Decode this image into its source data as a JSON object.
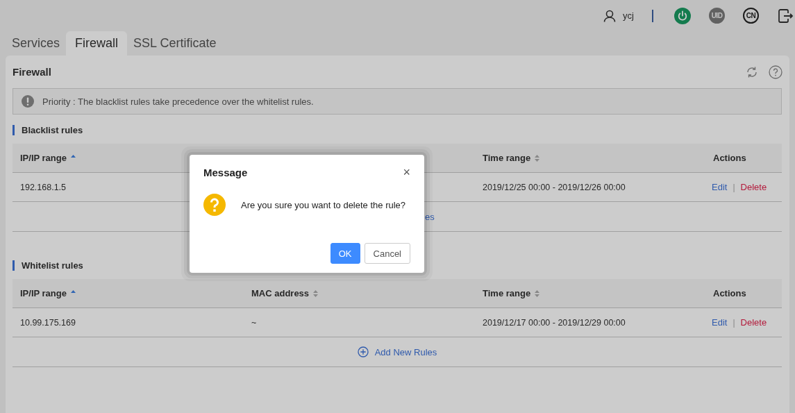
{
  "header": {
    "user": "ycj",
    "badges": [
      {
        "kind": "power"
      },
      {
        "kind": "text",
        "text": "UID",
        "filled": true
      },
      {
        "kind": "text",
        "text": "CN",
        "filled": false
      },
      {
        "kind": "logout"
      }
    ]
  },
  "tabs": [
    {
      "label": "Services",
      "selected": false
    },
    {
      "label": "Firewall",
      "selected": true
    },
    {
      "label": "SSL Certificate",
      "selected": false
    }
  ],
  "panel": {
    "title": "Firewall",
    "notice": "Priority : The blacklist rules take precedence over the whitelist rules.",
    "sections": [
      {
        "title": "Blacklist rules",
        "columns": [
          {
            "kind": "sorted",
            "label": "IP/IP range"
          },
          {
            "kind": "covered"
          },
          {
            "kind": "sortable",
            "label": "Time range"
          },
          {
            "kind": "plain",
            "label": "Actions"
          }
        ],
        "rows": [
          {
            "cells": [
              "192.168.1.5",
              "2019/12/25 00:00 - 2019/12/26 00:00"
            ],
            "actions": [
              {
                "kind": "edit",
                "label": "Edit"
              },
              {
                "kind": "delete",
                "label": "Delete"
              }
            ],
            "separator": "|"
          }
        ],
        "add_link": {
          "text": "es",
          "covered": true
        }
      },
      {
        "title": "Whitelist rules",
        "columns": [
          {
            "kind": "sorted",
            "label": "IP/IP range"
          },
          {
            "kind": "sortable",
            "label": "MAC address"
          },
          {
            "kind": "sortable",
            "label": "Time range"
          },
          {
            "kind": "plain",
            "label": "Actions"
          }
        ],
        "rows": [
          {
            "cells": [
              "10.99.175.169",
              "~",
              "2019/12/17 00:00 - 2019/12/29 00:00"
            ],
            "actions": [
              {
                "kind": "edit",
                "label": "Edit"
              },
              {
                "kind": "delete",
                "label": "Delete"
              }
            ],
            "separator": "|"
          }
        ],
        "add_link": {
          "text": "Add New Rules",
          "covered": false
        }
      }
    ]
  },
  "dialog": {
    "title": "Message",
    "close": "×",
    "message": "Are you sure you want to delete the rule?",
    "buttons": [
      {
        "kind": "primary",
        "label": "OK"
      },
      {
        "kind": "default",
        "label": "Cancel"
      }
    ]
  }
}
